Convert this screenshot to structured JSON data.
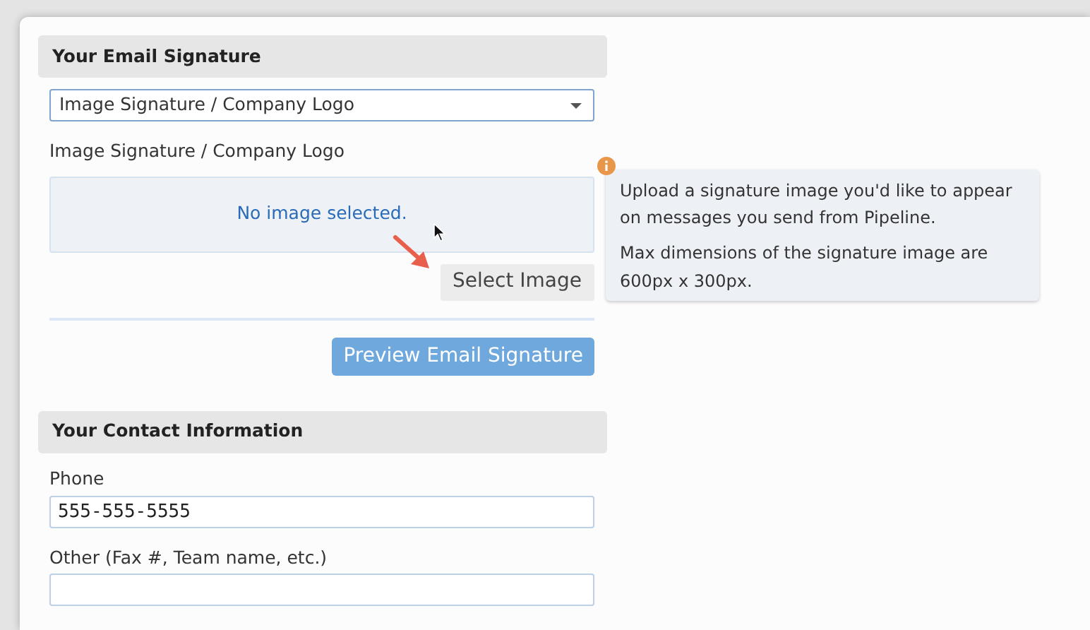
{
  "email_signature": {
    "title": "Your Email Signature",
    "select": {
      "value": "Image Signature / Company Logo"
    },
    "image_label": "Image Signature / Company Logo",
    "image_status": "No image selected.",
    "select_button": "Select Image",
    "preview_button": "Preview Email Signature"
  },
  "tooltip": {
    "paragraphs": [
      "Upload a signature image you'd like to appear on messages you send from Pipeline.",
      "Max dimensions of the signature image are 600px x 300px."
    ]
  },
  "contact_information": {
    "title": "Your Contact Information",
    "fields": [
      {
        "label": "Phone",
        "value": "555-555-5555"
      },
      {
        "label": "Other (Fax #, Team name, etc.)"
      }
    ]
  }
}
